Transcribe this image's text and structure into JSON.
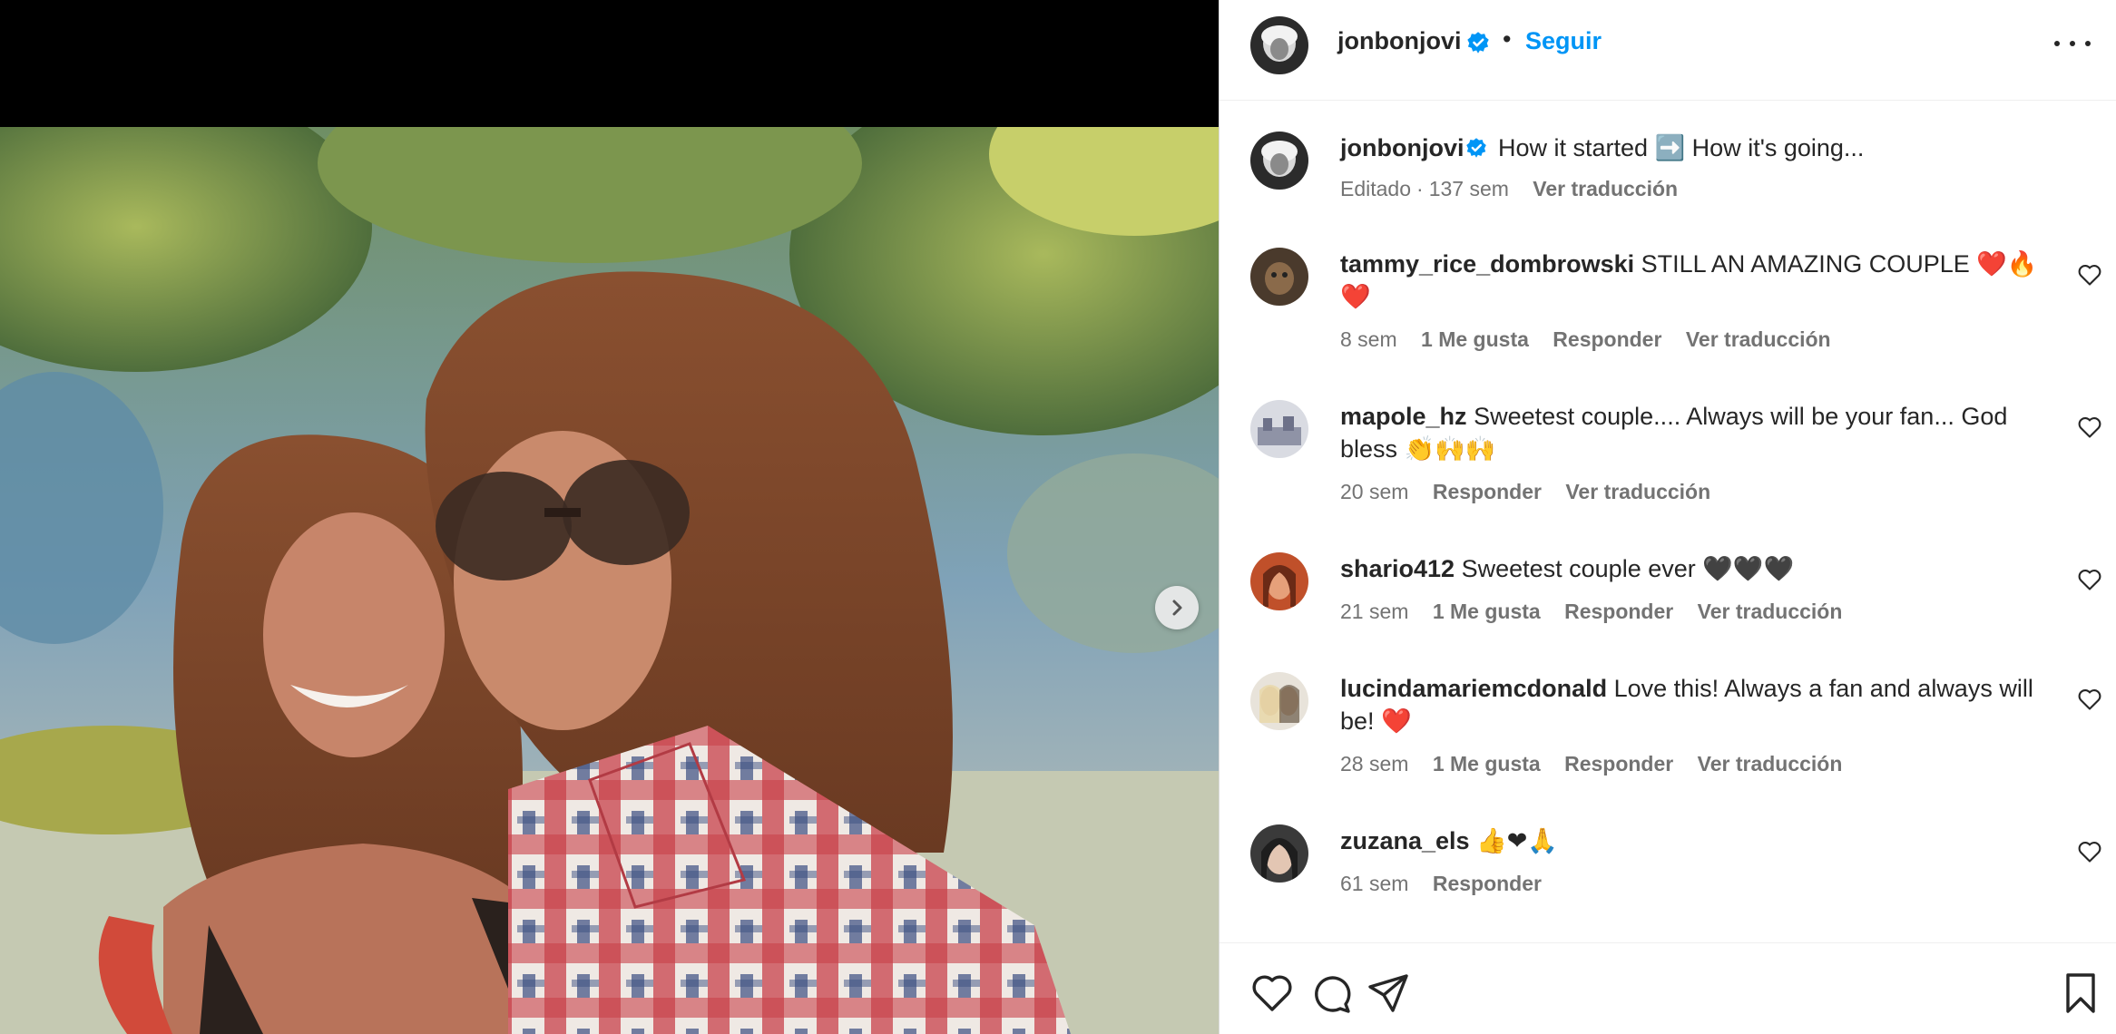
{
  "colors": {
    "link_blue": "#0095f6",
    "text": "#262626",
    "secondary_text": "#737373",
    "verified_badge": "#0095f6",
    "heart_red": "#e0182c"
  },
  "media": {
    "next_icon": "chevron-right-icon"
  },
  "header": {
    "username": "jonbonjovi",
    "separator": "•",
    "follow_label": "Seguir",
    "more_icon": "more-horizontal-icon",
    "verified_icon": "verified-badge-icon"
  },
  "caption": {
    "username": "jonbonjovi",
    "text": "How it started ➡️ How it's going...",
    "edited": "Editado",
    "dot": "·",
    "time": "137 sem",
    "translate": "Ver traducción"
  },
  "comments": [
    {
      "username": "tammy_rice_dombrowski",
      "text": "STILL AN AMAZING COUPLE ❤️🔥❤️",
      "time": "8 sem",
      "likes": "1 Me gusta",
      "reply": "Responder",
      "translate": "Ver traducción"
    },
    {
      "username": "mapole_hz",
      "text": "Sweetest couple.... Always will be your fan... God bless 👏🙌🙌",
      "time": "20 sem",
      "reply": "Responder",
      "translate": "Ver traducción"
    },
    {
      "username": "shario412",
      "text": "Sweetest couple ever 🖤🖤🖤",
      "time": "21 sem",
      "likes": "1 Me gusta",
      "reply": "Responder",
      "translate": "Ver traducción"
    },
    {
      "username": "lucindamariemcdonald",
      "text": "Love this! Always a fan and always will be! ❤️",
      "time": "28 sem",
      "likes": "1 Me gusta",
      "reply": "Responder",
      "translate": "Ver traducción"
    },
    {
      "username": "zuzana_els",
      "text": "👍❤🙏",
      "time": "61 sem",
      "reply": "Responder"
    }
  ],
  "actions": {
    "like_icon": "heart-icon",
    "comment_icon": "comment-icon",
    "share_icon": "paper-plane-icon",
    "save_icon": "bookmark-icon"
  }
}
